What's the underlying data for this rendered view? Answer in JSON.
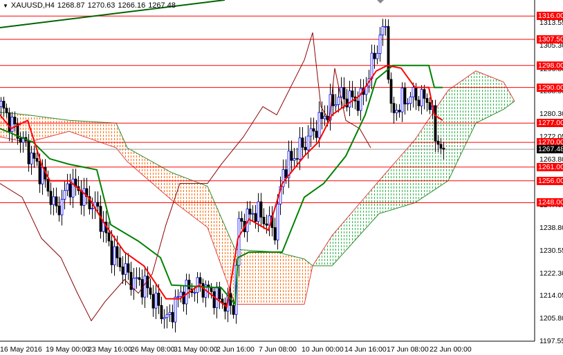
{
  "header": {
    "symbol": "XAUUSD,H4",
    "open": "1268.87",
    "high": "1270.63",
    "low": "1266.16",
    "close": "1267.48"
  },
  "colors": {
    "level": "#ff0000",
    "tenkan": "#ff0000",
    "kijun": "#008000",
    "chikou": "#8b0000",
    "bear_cloud": "#ff6a00",
    "bull_cloud": "#2fb24a",
    "trend": "#006400"
  },
  "levels": [
    "1316.00",
    "1307.50",
    "1298.00",
    "1290.00",
    "1277.00",
    "1270.00",
    "1261.00",
    "1256.00",
    "1248.00"
  ],
  "current_price": "1267.48",
  "price_ticks": [
    "1313.55",
    "1305.30",
    "1296.80",
    "1288.55",
    "1280.30",
    "1272.05",
    "1263.80",
    "1255.30",
    "1247.05",
    "1238.80",
    "1230.55",
    "1222.30",
    "1214.05",
    "1205.80",
    "1197.55"
  ],
  "time_labels": [
    "16 May 2016",
    "19 May 00:00",
    "23 May 16:00",
    "26 May 08:00",
    "31 May 00:00",
    "2 Jun 16:00",
    "7 Jun 08:00",
    "10 Jun 00:00",
    "14 Jun 16:00",
    "17 Jun 08:00",
    "22 Jun 00:00"
  ],
  "chart_data": {
    "type": "candlestick",
    "symbol": "XAUUSD",
    "timeframe": "H4",
    "ylim": [
      1197.55,
      1320
    ],
    "price_path": [
      [
        0,
        1283
      ],
      [
        5,
        1275
      ],
      [
        15,
        1258
      ],
      [
        20,
        1245
      ],
      [
        25,
        1255
      ],
      [
        35,
        1245
      ],
      [
        40,
        1230
      ],
      [
        47,
        1220
      ],
      [
        52,
        1218
      ],
      [
        60,
        1205
      ],
      [
        65,
        1215
      ],
      [
        72,
        1218
      ],
      [
        80,
        1212
      ],
      [
        84,
        1210
      ],
      [
        86,
        1240
      ],
      [
        92,
        1245
      ],
      [
        99,
        1238
      ],
      [
        102,
        1260
      ],
      [
        110,
        1270
      ],
      [
        117,
        1280
      ],
      [
        122,
        1287
      ],
      [
        130,
        1285
      ],
      [
        136,
        1305
      ],
      [
        139,
        1313
      ],
      [
        141,
        1280
      ],
      [
        145,
        1285
      ],
      [
        149,
        1287
      ],
      [
        155,
        1285
      ],
      [
        157,
        1272
      ],
      [
        160,
        1267.48
      ]
    ],
    "tenkan": [
      [
        0,
        1280
      ],
      [
        4,
        1275
      ],
      [
        10,
        1278
      ],
      [
        15,
        1262
      ],
      [
        18,
        1256
      ],
      [
        25,
        1256
      ],
      [
        32,
        1250
      ],
      [
        38,
        1240
      ],
      [
        45,
        1230
      ],
      [
        52,
        1225
      ],
      [
        60,
        1213
      ],
      [
        65,
        1213
      ],
      [
        72,
        1218
      ],
      [
        82,
        1210
      ],
      [
        86,
        1235
      ],
      [
        90,
        1242
      ],
      [
        97,
        1238
      ],
      [
        102,
        1255
      ],
      [
        110,
        1265
      ],
      [
        115,
        1270
      ],
      [
        120,
        1280
      ],
      [
        130,
        1287
      ],
      [
        136,
        1296
      ],
      [
        140,
        1298
      ],
      [
        145,
        1297
      ],
      [
        150,
        1290
      ],
      [
        155,
        1290
      ],
      [
        157,
        1280
      ],
      [
        160,
        1278
      ]
    ],
    "kijun": [
      [
        0,
        1275
      ],
      [
        12,
        1270
      ],
      [
        18,
        1264
      ],
      [
        25,
        1262
      ],
      [
        35,
        1260
      ],
      [
        40,
        1240
      ],
      [
        50,
        1234
      ],
      [
        58,
        1228
      ],
      [
        62,
        1218
      ],
      [
        80,
        1217
      ],
      [
        85,
        1211
      ],
      [
        86,
        1228
      ],
      [
        90,
        1230
      ],
      [
        102,
        1230
      ],
      [
        110,
        1250
      ],
      [
        117,
        1255
      ],
      [
        125,
        1265
      ],
      [
        132,
        1280
      ],
      [
        136,
        1293
      ],
      [
        142,
        1298
      ],
      [
        155,
        1298
      ],
      [
        157,
        1290
      ],
      [
        160,
        1290
      ]
    ],
    "chikou": [
      [
        0,
        1255
      ],
      [
        8,
        1250
      ],
      [
        15,
        1235
      ],
      [
        22,
        1228
      ],
      [
        28,
        1215
      ],
      [
        33,
        1205
      ],
      [
        38,
        1212
      ],
      [
        45,
        1220
      ],
      [
        50,
        1215
      ],
      [
        55,
        1222
      ],
      [
        60,
        1240
      ],
      [
        65,
        1255
      ],
      [
        75,
        1255
      ],
      [
        80,
        1262
      ],
      [
        88,
        1272
      ],
      [
        95,
        1283
      ],
      [
        100,
        1280
      ],
      [
        105,
        1290
      ],
      [
        110,
        1300
      ],
      [
        113,
        1310
      ],
      [
        116,
        1283
      ],
      [
        119,
        1278
      ],
      [
        121,
        1297
      ],
      [
        125,
        1278
      ],
      [
        130,
        1275
      ],
      [
        134,
        1268
      ]
    ],
    "cloud": [
      [
        0,
        1272,
        1281
      ],
      [
        10,
        1270,
        1280
      ],
      [
        25,
        1274,
        1278
      ],
      [
        42,
        1268,
        1277
      ],
      [
        46,
        1263,
        1268
      ],
      [
        62,
        1249,
        1259
      ],
      [
        75,
        1239,
        1254
      ],
      [
        85,
        1211,
        1231
      ],
      [
        100,
        1211,
        1230
      ],
      [
        110,
        1211,
        1227.5
      ],
      [
        113,
        1225,
        1225
      ],
      [
        120,
        1236,
        1225
      ],
      [
        137,
        1256,
        1244
      ],
      [
        150,
        1271,
        1248
      ],
      [
        162,
        1289,
        1256
      ],
      [
        172,
        1296,
        1277
      ],
      [
        182,
        1292,
        1282
      ],
      [
        186,
        1285,
        1285
      ]
    ]
  }
}
